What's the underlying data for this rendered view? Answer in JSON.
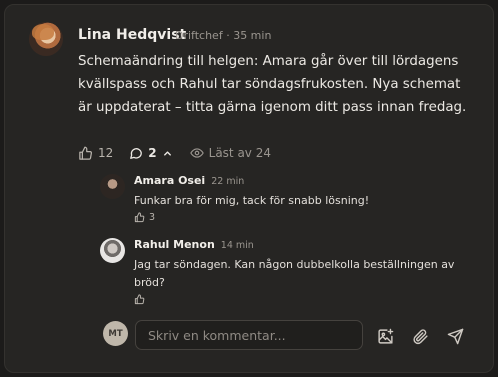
{
  "post": {
    "author": "Lina Hedqvist",
    "meta": "Driftchef · 35 min",
    "message": "Schemaändring till helgen: Amara går över till lördagens kvällspass och Rahul tar söndagsfrukosten. Nya schemat är uppdaterat – titta gärna igenom ditt pass innan fredag.",
    "likes": "12",
    "replies": "2",
    "seen": "Läst av 24"
  },
  "replies": [
    {
      "author": "Amara Osei",
      "time": "22 min",
      "text": "Funkar bra för mig, tack för snabb lösning!",
      "likes": "3"
    },
    {
      "author": "Rahul Menon",
      "time": "14 min",
      "text": "Jag tar söndagen. Kan någon dubbelkolla beställningen av bröd?",
      "likes": ""
    }
  ],
  "composer": {
    "initials": "MT",
    "placeholder": "Skriv en kommentar..."
  },
  "icons": {
    "like": "thumbs-up-icon",
    "comment": "comment-icon",
    "collapse": "chevron-up-icon",
    "seen": "eye-icon",
    "image": "image-plus-icon",
    "attach": "paperclip-icon",
    "send": "send-icon"
  }
}
